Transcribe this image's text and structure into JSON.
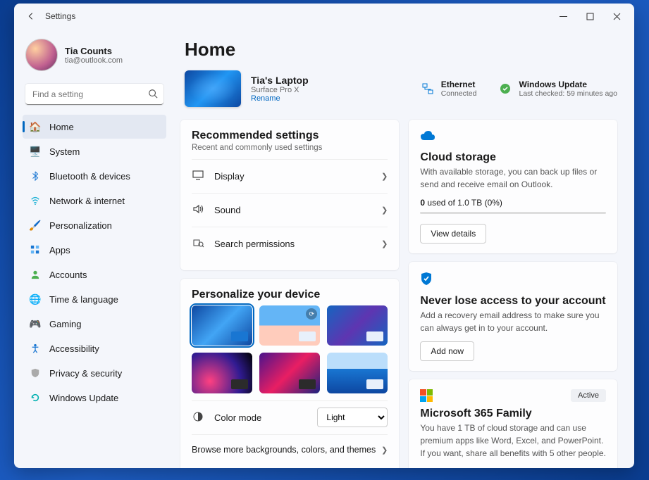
{
  "window": {
    "title": "Settings"
  },
  "profile": {
    "name": "Tia Counts",
    "email": "tia@outlook.com"
  },
  "search": {
    "placeholder": "Find a setting"
  },
  "sidebar": {
    "items": [
      {
        "label": "Home",
        "icon": "home-icon"
      },
      {
        "label": "System",
        "icon": "system-icon"
      },
      {
        "label": "Bluetooth & devices",
        "icon": "bluetooth-icon"
      },
      {
        "label": "Network & internet",
        "icon": "wifi-icon"
      },
      {
        "label": "Personalization",
        "icon": "brush-icon"
      },
      {
        "label": "Apps",
        "icon": "apps-icon"
      },
      {
        "label": "Accounts",
        "icon": "accounts-icon"
      },
      {
        "label": "Time & language",
        "icon": "globe-icon"
      },
      {
        "label": "Gaming",
        "icon": "gaming-icon"
      },
      {
        "label": "Accessibility",
        "icon": "accessibility-icon"
      },
      {
        "label": "Privacy & security",
        "icon": "shield-icon"
      },
      {
        "label": "Windows Update",
        "icon": "update-icon"
      }
    ]
  },
  "page": {
    "title": "Home"
  },
  "device": {
    "name": "Tia's Laptop",
    "model": "Surface Pro X",
    "rename": "Rename"
  },
  "status": {
    "network": {
      "title": "Ethernet",
      "sub": "Connected"
    },
    "update": {
      "title": "Windows Update",
      "sub": "Last checked: 59 minutes ago"
    }
  },
  "recommended": {
    "title": "Recommended settings",
    "sub": "Recent and commonly used settings",
    "items": [
      {
        "label": "Display"
      },
      {
        "label": "Sound"
      },
      {
        "label": "Search permissions"
      }
    ]
  },
  "personalize": {
    "title": "Personalize your device",
    "color_mode_label": "Color mode",
    "color_mode_value": "Light",
    "browse": "Browse more backgrounds, colors, and themes"
  },
  "cloud": {
    "title": "Cloud storage",
    "desc": "With available storage, you can back up files or send and receive email on Outlook.",
    "usage_prefix": "0",
    "usage_rest": " used of 1.0 TB (0%)",
    "button": "View details"
  },
  "recovery": {
    "title": "Never lose access to your account",
    "desc": "Add a recovery email address to make sure you can always get in to your account.",
    "button": "Add now"
  },
  "m365": {
    "badge": "Active",
    "title": "Microsoft 365 Family",
    "desc": "You have 1 TB of cloud storage and can use premium apps like Word, Excel, and PowerPoint. If you want, share all benefits with 5 other people."
  }
}
